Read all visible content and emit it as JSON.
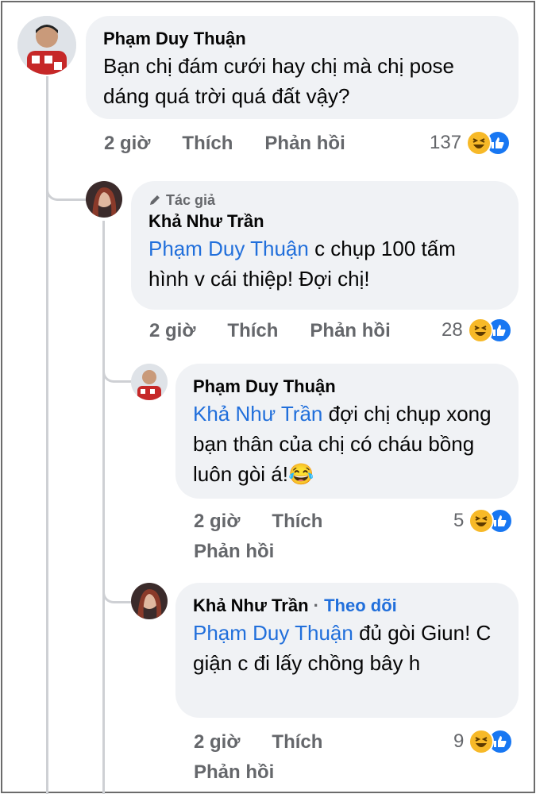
{
  "comments": [
    {
      "author": "Phạm Duy Thuận",
      "text": "Bạn chị đám cưới hay chị mà chị pose dáng quá trời quá đất vậy?",
      "time": "2 giờ",
      "like": "Thích",
      "reply": "Phản hồi",
      "reaction_count": "137"
    },
    {
      "badge": "Tác giả",
      "author": "Khả Như Trần",
      "mention": "Phạm Duy Thuận",
      "text": " c chụp 100 tấm hình v cái thiệp! Đợi chị!",
      "time": "2 giờ",
      "like": "Thích",
      "reply": "Phản hồi",
      "reaction_count": "28"
    },
    {
      "author": "Phạm Duy Thuận",
      "mention": "Khả Như Trần",
      "text": " đợi chị chụp xong bạn thân của chị có cháu bồng luôn gòi á!😂",
      "time": "2 giờ",
      "like": "Thích",
      "reply": "Phản hồi",
      "reaction_count": "5"
    },
    {
      "author": "Khả Như Trần",
      "separator": "·",
      "follow": "Theo dõi",
      "mention": "Phạm Duy Thuận",
      "text": " đủ gòi Giun! C giận c đi lấy chồng bây h",
      "time": "2 giờ",
      "like": "Thích",
      "reply": "Phản hồi",
      "reaction_count": "9"
    }
  ],
  "reaction_icons": [
    "haha-icon",
    "like-icon"
  ],
  "colors": {
    "mention": "#216fdb",
    "meta": "#65676b",
    "bubble": "#f0f2f5",
    "like": "#1877f2",
    "haha": "#f7b928"
  }
}
